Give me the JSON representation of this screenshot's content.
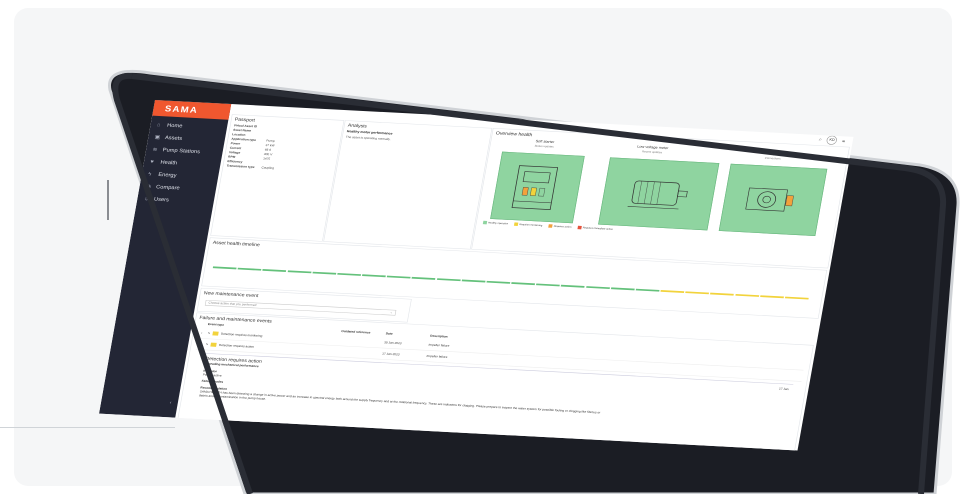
{
  "brand": "SAMA",
  "nav": [
    {
      "icon": "home-icon",
      "glyph": "⌂",
      "label": "Home"
    },
    {
      "icon": "assets-icon",
      "glyph": "▣",
      "label": "Assets"
    },
    {
      "icon": "pump-stations-icon",
      "glyph": "≋",
      "label": "Pump Stations"
    },
    {
      "icon": "health-icon",
      "glyph": "♥",
      "label": "Health"
    },
    {
      "icon": "energy-icon",
      "glyph": "ϟ",
      "label": "Energy"
    },
    {
      "icon": "compare-icon",
      "glyph": "◉",
      "label": "Compare"
    },
    {
      "icon": "users-icon",
      "glyph": "☺",
      "label": "Users"
    }
  ],
  "topbar": {
    "search_glyph": "⌕",
    "avatar": "KD",
    "menu_glyph": "≡"
  },
  "passport": {
    "title": "Passport",
    "rows": [
      {
        "k": "Virtual Asset ID",
        "v": ""
      },
      {
        "k": "Asset Name",
        "v": ""
      },
      {
        "k": "Location",
        "v": ""
      },
      {
        "k": "Application type",
        "v": "Pump"
      },
      {
        "k": "Power",
        "v": "37 kW"
      },
      {
        "k": "Current",
        "v": "68 A"
      },
      {
        "k": "Voltage",
        "v": "400 V"
      },
      {
        "k": "RPM",
        "v": "1475"
      },
      {
        "k": "Efficiency",
        "v": ""
      },
      {
        "k": "Transmission type",
        "v": "Coupling"
      }
    ]
  },
  "analysis": {
    "title": "Analysis",
    "heading": "Healthy motor performance",
    "text": "The asset is operating normally."
  },
  "overview": {
    "title": "Overview health",
    "boxes": [
      {
        "label": "Soft starter",
        "sub": "Status updates"
      },
      {
        "label": "Low voltage motor",
        "sub": "Recent updates"
      },
      {
        "label": "Coupling",
        "sub": "Connections"
      }
    ],
    "legend": [
      {
        "label": "Healthy operation",
        "color": "#8fd4a0"
      },
      {
        "label": "Requires monitoring",
        "color": "#f2d33c"
      },
      {
        "label": "Requires action",
        "color": "#f2a13c"
      },
      {
        "label": "Requires immediate action",
        "color": "#e5533d"
      }
    ]
  },
  "timeline": {
    "title": "Asset health timeline",
    "segments": [
      "#64c17b",
      "#64c17b",
      "#64c17b",
      "#64c17b",
      "#64c17b",
      "#64c17b",
      "#64c17b",
      "#64c17b",
      "#64c17b",
      "#64c17b",
      "#64c17b",
      "#64c17b",
      "#64c17b",
      "#64c17b",
      "#64c17b",
      "#64c17b",
      "#64c17b",
      "#64c17b",
      "#f2d33c",
      "#f2d33c",
      "#f2d33c",
      "#f2d33c",
      "#f2d33c",
      "#f2d33c"
    ]
  },
  "maintenance": {
    "title": "New maintenance event",
    "placeholder": "Choose action that you performed"
  },
  "events": {
    "title": "Failure and maintenance events",
    "headers": [
      "Event type",
      "Outdated reference",
      "Date",
      "Description"
    ],
    "rows": [
      {
        "type": "Detection requires monitoring",
        "date": "30 Jan 2023",
        "desc": "Impeller failure"
      },
      {
        "type": "Detection requires action",
        "date": "17 Jan 2023",
        "desc": "Impeller failure"
      }
    ]
  },
  "detail": {
    "title": "Detection requires action",
    "date": "17 Jan",
    "subtitle": "Degrading mechanical performance",
    "indicator_label": "Indicator",
    "indicator": "Power, active",
    "failure_label": "Failure modes",
    "recommendation_label": "Recommendation",
    "recommendation": "SAMA HEALTH has been detecting a change in active power and an increase in spectral energy both around the supply frequency and at the rotational frequency. These are indicators for clogging. Please prepare to inspect the water system for possible fouling or clogging like fibrous or debris and/or contamination in the pump house."
  },
  "colors": {
    "accent": "#f0572f",
    "sidebar": "#232635",
    "healthy": "#8fd4a0"
  }
}
